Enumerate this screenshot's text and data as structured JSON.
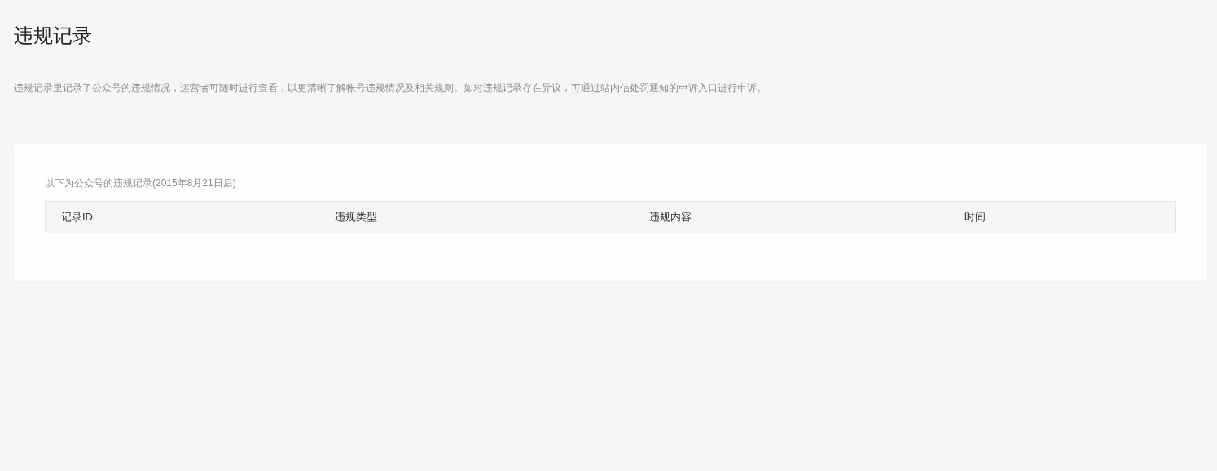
{
  "page": {
    "title": "违规记录",
    "description": "违规记录里记录了公众号的违规情况，运营者可随时进行查看，以更清晰了解帐号违规情况及相关规则。如对违规记录存在异议，可通过站内信处罚通知的申诉入口进行申诉。"
  },
  "records": {
    "caption": "以下为公众号的违规记录(2015年8月21日后)",
    "columns": [
      "记录ID",
      "违规类型",
      "违规内容",
      "时间"
    ]
  }
}
